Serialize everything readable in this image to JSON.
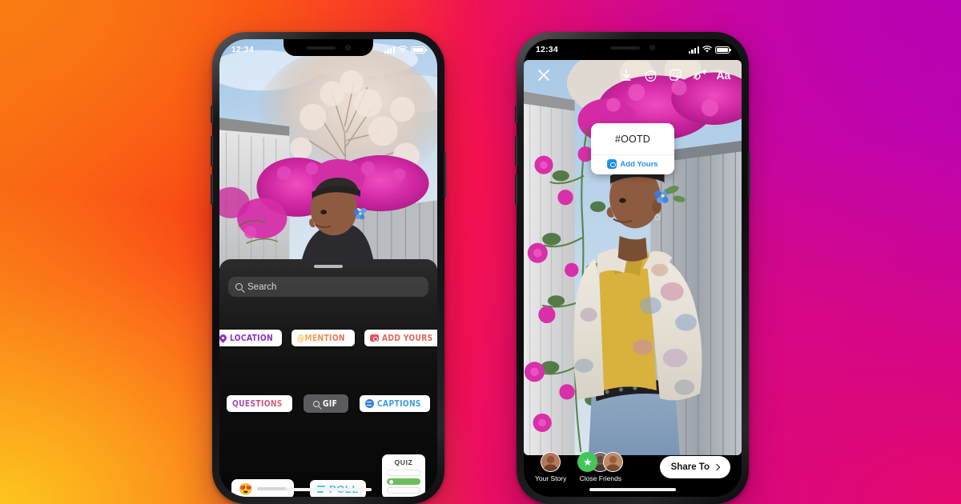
{
  "background": {
    "gradient_colors": [
      "#F97C12",
      "#FDC51E",
      "#FB3A17",
      "#F4114F",
      "#E4086B",
      "#B902B4"
    ]
  },
  "phone_left": {
    "status_bar": {
      "time": "12:34",
      "cellular_icon": "signal-bars-icon",
      "wifi_icon": "wifi-icon",
      "battery_icon": "battery-icon"
    },
    "photo_alt": "person with blue flower in hair in front of pink bougainvillea",
    "sheet": {
      "grabber": "sheet-grabber",
      "search": {
        "placeholder": "Search",
        "icon": "search-icon"
      },
      "stickers": [
        {
          "id": "location",
          "label": "LOCATION",
          "icon": "map-pin-icon",
          "color": "#8C2FC7"
        },
        {
          "id": "mention",
          "label": "@MENTION",
          "icon": "none",
          "color": "#EF8B4C"
        },
        {
          "id": "add-yours",
          "label": "ADD YOURS",
          "icon": "camera-icon",
          "color": "#E8645C"
        },
        {
          "id": "questions",
          "label": "QUESTIONS",
          "icon": "none",
          "color": "#D1497F"
        },
        {
          "id": "gif",
          "label": "GIF",
          "icon": "search-icon",
          "color": "#FFFFFF"
        },
        {
          "id": "captions",
          "label": "CAPTIONS",
          "icon": "closed-caption-icon",
          "color": "#3E9BEA"
        },
        {
          "id": "emoji-slider",
          "label": "",
          "icon": "heart-eyes-emoji",
          "color": "#D7D7DC"
        },
        {
          "id": "poll",
          "label": "POLL",
          "icon": "poll-bars-icon",
          "color": "#4FC3C8"
        },
        {
          "id": "quiz",
          "label": "QUIZ",
          "icon": "none",
          "color": "#6BBE5A"
        }
      ],
      "emoji_slider": {
        "emoji": "😍"
      },
      "quiz": {
        "title": "QUIZ",
        "options": [
          "",
          "",
          ""
        ],
        "correct_index": 1
      }
    }
  },
  "phone_right": {
    "status_bar": {
      "time": "12:34",
      "cellular_icon": "signal-bars-icon",
      "wifi_icon": "wifi-icon",
      "battery_icon": "battery-icon"
    },
    "photo_alt": "person in floral print jacket and yellow shirt standing by bougainvillea",
    "toolbar": [
      {
        "id": "close",
        "icon": "close-icon"
      },
      {
        "id": "save",
        "icon": "download-icon"
      },
      {
        "id": "effects",
        "icon": "sparkle-face-icon"
      },
      {
        "id": "stickers",
        "icon": "sticker-smiley-icon"
      },
      {
        "id": "draw",
        "icon": "scribble-pen-icon"
      },
      {
        "id": "text",
        "icon": "text-aa-icon",
        "label": "Aa"
      }
    ],
    "add_yours_sticker": {
      "prompt": "#OOTD",
      "action_label": "Add Yours",
      "action_icon": "camera-icon",
      "action_color": "#2F8FE8"
    },
    "share_bar": {
      "your_story": {
        "label": "Your Story",
        "icon": "avatar"
      },
      "close_friends": {
        "label": "Close Friends",
        "icon": "green-star-icon",
        "star": "★"
      },
      "share_to": {
        "label": "Share To",
        "icon": "chevron-right-icon"
      }
    }
  }
}
